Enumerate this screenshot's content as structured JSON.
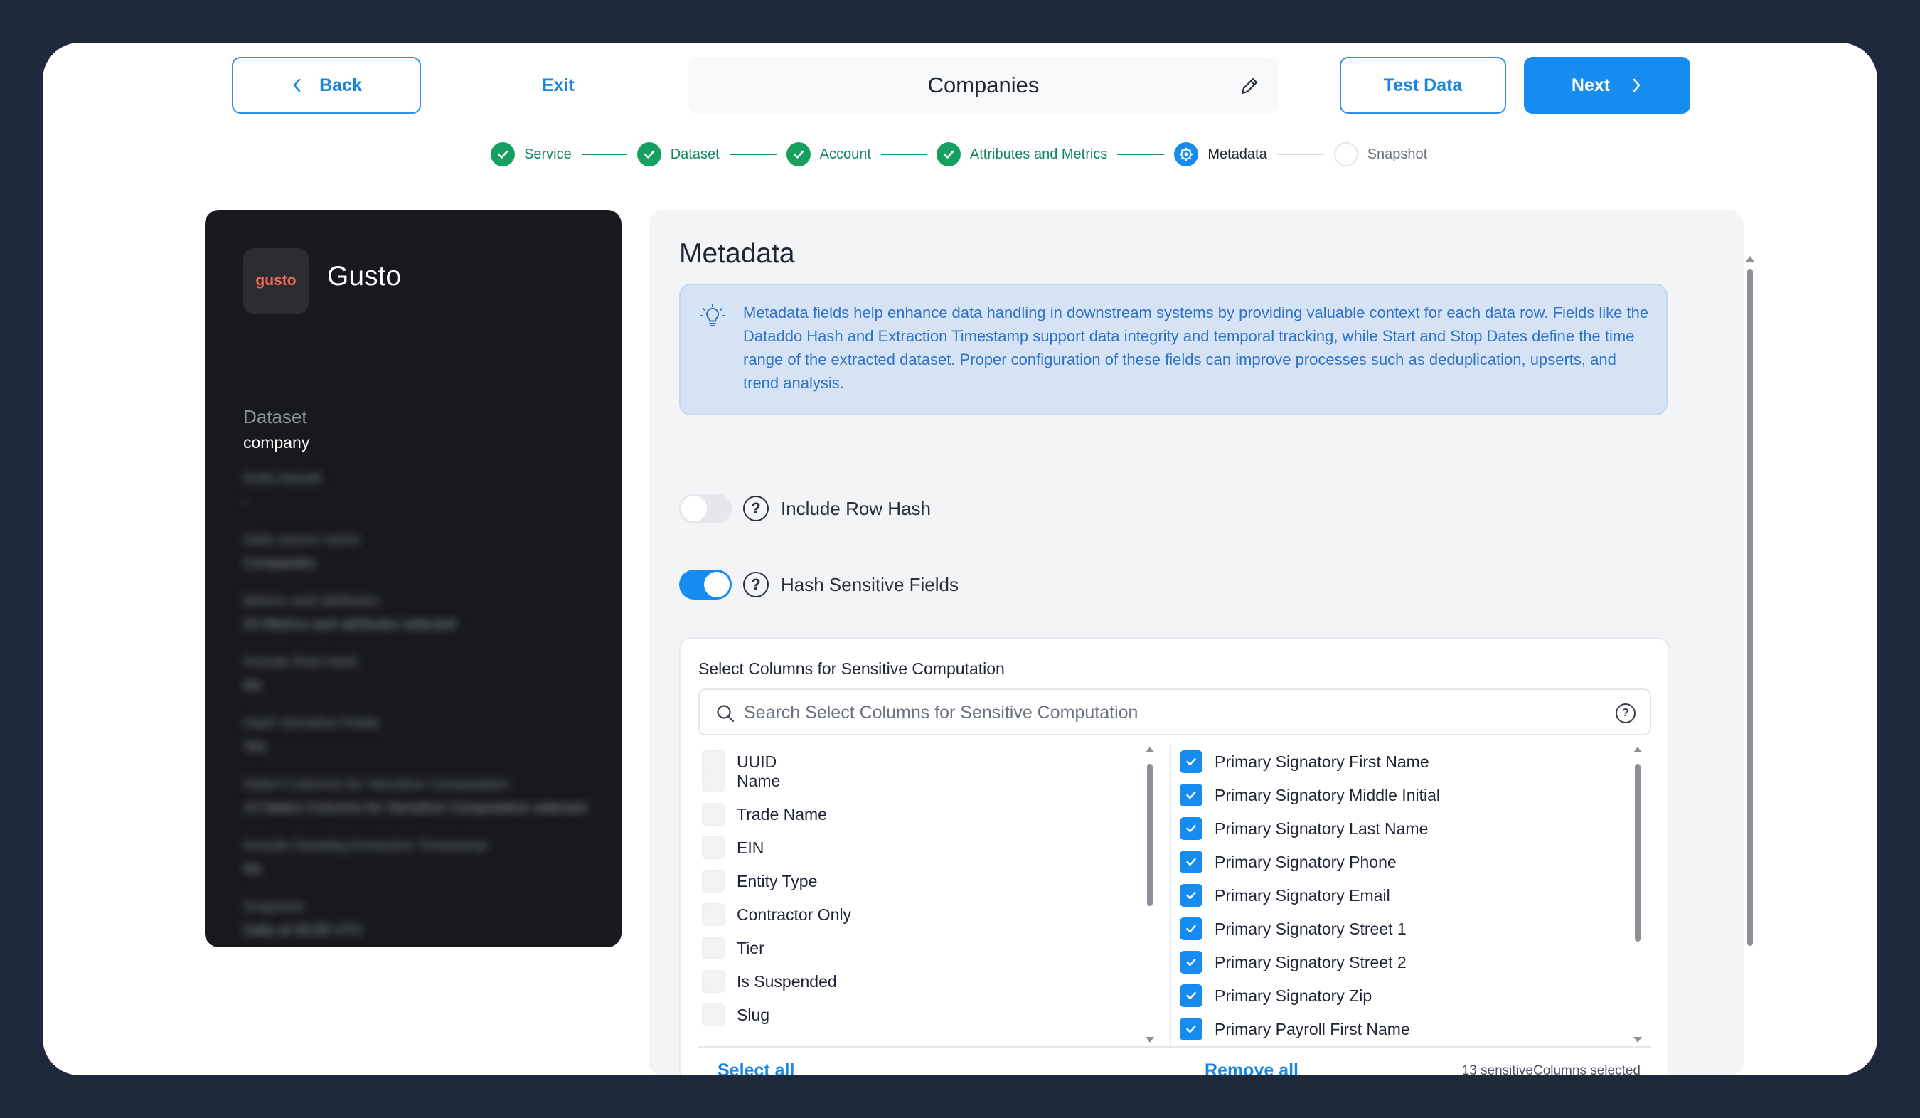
{
  "header": {
    "back_label": "Back",
    "exit_label": "Exit",
    "title": "Companies",
    "test_data_label": "Test Data",
    "next_label": "Next"
  },
  "stepper": {
    "steps": [
      {
        "label": "Service",
        "state": "done"
      },
      {
        "label": "Dataset",
        "state": "done"
      },
      {
        "label": "Account",
        "state": "done"
      },
      {
        "label": "Attributes and Metrics",
        "state": "done"
      },
      {
        "label": "Metadata",
        "state": "active"
      },
      {
        "label": "Snapshot",
        "state": "todo"
      }
    ]
  },
  "sidebar": {
    "logo_text": "gusto",
    "brand": "Gusto",
    "dataset_label": "Dataset",
    "dataset_value": "company",
    "blurred": [
      {
        "label": "Nulla blandit",
        "value": "-"
      },
      {
        "label": "Data source name",
        "value": "Companies"
      },
      {
        "label": "Metrics and attributes",
        "value": "33 Metrics and attributes selected"
      },
      {
        "label": "Include Row Hash",
        "value": "No"
      },
      {
        "label": "Hash Sensitive Fields",
        "value": "Yes"
      },
      {
        "label": "Select Columns for Sensitive Computation",
        "value": "13 Select Columns for Sensitive Computation selected"
      },
      {
        "label": "Include Datadog Extraction Timestamp",
        "value": "No"
      },
      {
        "label": "Snapshot",
        "value": "Daily at 00:00 UTC"
      }
    ]
  },
  "metadata": {
    "heading": "Metadata",
    "info_text": "Metadata fields help enhance data handling in downstream systems by providing valuable context for each data row. Fields like the Dataddo Hash and Extraction Timestamp support data integrity and temporal tracking, while Start and Stop Dates define the time range of the extracted dataset. Proper configuration of these fields can improve processes such as deduplication, upserts, and trend analysis.",
    "include_row_hash": {
      "label": "Include Row Hash",
      "enabled": false
    },
    "hash_sensitive": {
      "label": "Hash Sensitive Fields",
      "enabled": true
    },
    "columns": {
      "heading": "Select Columns for Sensitive Computation",
      "search_placeholder": "Search Select Columns for Sensitive Computation",
      "available": [
        "UUID",
        "Name",
        "Trade Name",
        "EIN",
        "Entity Type",
        "Contractor Only",
        "Tier",
        "Is Suspended",
        "Slug"
      ],
      "selected": [
        "Primary Signatory First Name",
        "Primary Signatory Middle Initial",
        "Primary Signatory Last Name",
        "Primary Signatory Phone",
        "Primary Signatory Email",
        "Primary Signatory Street 1",
        "Primary Signatory Street 2",
        "Primary Signatory Zip",
        "Primary Payroll First Name"
      ],
      "select_all_label": "Select all",
      "remove_all_label": "Remove all",
      "count_text": "13 sensitiveColumns selected"
    }
  },
  "colors": {
    "accent": "#168cf0",
    "success": "#14a05e",
    "frame": "#1e293b",
    "sidebar_bg": "#17191d",
    "info_bg": "#d5e3f4",
    "info_text": "#2f74c8"
  }
}
